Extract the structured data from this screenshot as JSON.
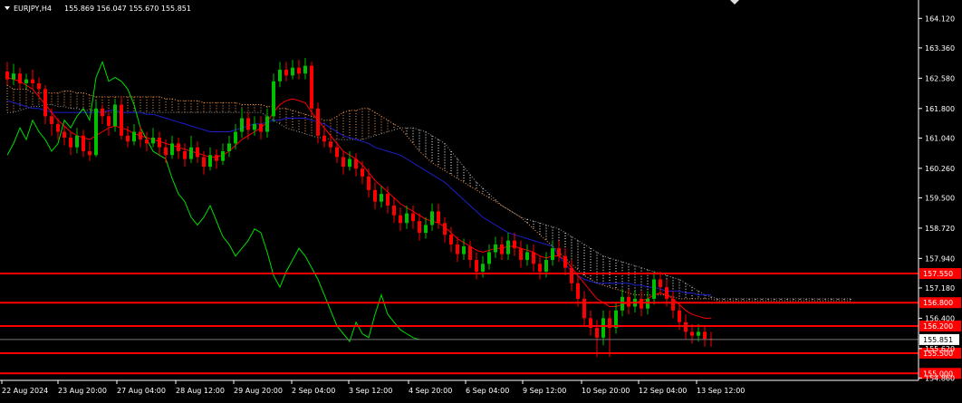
{
  "header": {
    "symbol_label": "EURJPY,H4",
    "ohlc": "155.869 156.047 155.670 155.851"
  },
  "colors": {
    "background": "#000000",
    "axis": "#ffffff",
    "bull": "#00c000",
    "bear": "#ff0000",
    "tenkan": "#ff0000",
    "kijun": "#1e1ecc",
    "chikou": "#00dd00",
    "cloud_a": "#ff9a4a",
    "cloud_b": "#ffffff",
    "level": "#ff0000",
    "current_price_box": "#ffffff"
  },
  "chart_data": {
    "type": "candlestick",
    "ylim": [
      154.8,
      164.5
    ],
    "y_ticks": [
      "164.120",
      "163.360",
      "162.580",
      "161.800",
      "161.040",
      "160.260",
      "159.500",
      "158.720",
      "157.940",
      "157.180",
      "156.400",
      "155.620",
      "154.860"
    ],
    "x_ticks": [
      "22 Aug 2024",
      "23 Aug 20:00",
      "27 Aug 04:00",
      "28 Aug 12:00",
      "29 Aug 20:00",
      "2 Sep 04:00",
      "3 Sep 12:00",
      "4 Sep 20:00",
      "6 Sep 04:00",
      "9 Sep 12:00",
      "10 Sep 20:00",
      "12 Sep 04:00",
      "13 Sep 12:00"
    ],
    "levels": [
      {
        "label": "157.550",
        "value": 157.55
      },
      {
        "label": "156.800",
        "value": 156.8
      },
      {
        "label": "156.200",
        "value": 156.2
      },
      {
        "label": "155.500",
        "value": 155.5
      },
      {
        "label": "155.000",
        "value": 154.98
      }
    ],
    "current_price": {
      "label": "155.851",
      "value": 155.851
    },
    "candles": [
      [
        162.75,
        162.55,
        163.0,
        162.4
      ],
      [
        162.55,
        162.7,
        162.95,
        162.4
      ],
      [
        162.7,
        162.45,
        162.85,
        162.3
      ],
      [
        162.45,
        162.55,
        162.7,
        162.3
      ],
      [
        162.55,
        162.45,
        162.8,
        162.3
      ],
      [
        162.45,
        162.3,
        162.6,
        162.1
      ],
      [
        162.3,
        161.6,
        162.4,
        161.4
      ],
      [
        161.6,
        161.4,
        161.8,
        161.1
      ],
      [
        161.4,
        161.2,
        161.55,
        161.0
      ],
      [
        161.2,
        161.05,
        161.35,
        160.85
      ],
      [
        161.05,
        160.8,
        161.2,
        160.6
      ],
      [
        160.8,
        161.1,
        161.3,
        160.65
      ],
      [
        161.1,
        160.7,
        161.25,
        160.55
      ],
      [
        160.7,
        160.6,
        160.95,
        160.45
      ],
      [
        160.6,
        161.8,
        162.0,
        160.55
      ],
      [
        161.8,
        161.6,
        161.9,
        161.4
      ],
      [
        161.6,
        161.35,
        161.75,
        161.1
      ],
      [
        161.35,
        161.9,
        162.05,
        161.2
      ],
      [
        161.9,
        161.1,
        162.1,
        161.0
      ],
      [
        161.1,
        160.95,
        161.35,
        160.8
      ],
      [
        160.95,
        161.2,
        161.4,
        160.85
      ],
      [
        161.2,
        161.0,
        161.35,
        160.8
      ],
      [
        161.0,
        160.9,
        161.2,
        160.7
      ],
      [
        160.9,
        161.05,
        161.3,
        160.8
      ],
      [
        161.05,
        160.8,
        161.2,
        160.6
      ],
      [
        160.8,
        160.6,
        161.0,
        160.4
      ],
      [
        160.6,
        160.9,
        161.1,
        160.5
      ],
      [
        160.9,
        160.7,
        161.05,
        160.5
      ],
      [
        160.7,
        160.5,
        160.9,
        160.3
      ],
      [
        160.5,
        160.8,
        161.1,
        160.4
      ],
      [
        160.8,
        160.55,
        160.95,
        160.4
      ],
      [
        160.55,
        160.3,
        160.7,
        160.1
      ],
      [
        160.3,
        160.6,
        160.8,
        160.2
      ],
      [
        160.6,
        160.45,
        160.75,
        160.25
      ],
      [
        160.45,
        160.7,
        160.9,
        160.35
      ],
      [
        160.7,
        160.9,
        161.1,
        160.55
      ],
      [
        160.9,
        161.2,
        161.4,
        160.75
      ],
      [
        161.2,
        161.55,
        161.8,
        161.05
      ],
      [
        161.55,
        161.25,
        161.7,
        161.0
      ],
      [
        161.25,
        161.4,
        161.6,
        161.1
      ],
      [
        161.4,
        161.2,
        161.6,
        161.0
      ],
      [
        161.2,
        161.6,
        161.8,
        161.05
      ],
      [
        161.6,
        162.5,
        162.7,
        161.45
      ],
      [
        162.5,
        162.8,
        163.0,
        162.35
      ],
      [
        162.8,
        162.65,
        163.0,
        162.5
      ],
      [
        162.65,
        162.85,
        163.05,
        162.55
      ],
      [
        162.85,
        162.7,
        163.05,
        162.55
      ],
      [
        162.7,
        162.9,
        163.1,
        162.55
      ],
      [
        162.9,
        161.8,
        163.0,
        161.6
      ],
      [
        161.8,
        161.1,
        161.95,
        160.9
      ],
      [
        161.1,
        160.95,
        161.35,
        160.8
      ],
      [
        160.95,
        160.8,
        161.1,
        160.65
      ],
      [
        160.8,
        160.55,
        160.95,
        160.4
      ],
      [
        160.55,
        160.3,
        160.7,
        160.1
      ],
      [
        160.3,
        160.5,
        160.7,
        160.2
      ],
      [
        160.5,
        160.25,
        160.65,
        160.05
      ],
      [
        160.25,
        160.05,
        160.45,
        159.85
      ],
      [
        160.05,
        159.7,
        160.25,
        159.5
      ],
      [
        159.7,
        159.4,
        159.9,
        159.2
      ],
      [
        159.4,
        159.6,
        159.8,
        159.25
      ],
      [
        159.6,
        159.3,
        159.8,
        159.1
      ],
      [
        159.3,
        159.05,
        159.5,
        158.85
      ],
      [
        159.05,
        158.85,
        159.25,
        158.65
      ],
      [
        158.85,
        159.1,
        159.3,
        158.7
      ],
      [
        159.1,
        158.9,
        159.3,
        158.7
      ],
      [
        158.9,
        158.6,
        159.1,
        158.4
      ],
      [
        158.6,
        158.8,
        159.0,
        158.45
      ],
      [
        158.8,
        159.15,
        159.35,
        158.65
      ],
      [
        159.15,
        158.85,
        159.35,
        158.7
      ],
      [
        158.85,
        158.55,
        159.0,
        158.35
      ],
      [
        158.55,
        158.3,
        158.75,
        158.1
      ],
      [
        158.3,
        158.05,
        158.5,
        157.85
      ],
      [
        158.05,
        158.25,
        158.45,
        157.9
      ],
      [
        158.25,
        157.9,
        158.4,
        157.7
      ],
      [
        157.9,
        157.6,
        158.1,
        157.4
      ],
      [
        157.6,
        157.8,
        158.0,
        157.45
      ],
      [
        157.8,
        158.1,
        158.3,
        157.65
      ],
      [
        158.1,
        158.3,
        158.5,
        157.95
      ],
      [
        158.3,
        158.05,
        158.5,
        157.9
      ],
      [
        158.05,
        158.4,
        158.6,
        157.9
      ],
      [
        158.4,
        158.2,
        158.6,
        158.0
      ],
      [
        158.2,
        157.9,
        158.4,
        157.7
      ],
      [
        157.9,
        158.1,
        158.3,
        157.75
      ],
      [
        158.1,
        157.8,
        158.3,
        157.6
      ],
      [
        157.8,
        157.6,
        158.0,
        157.4
      ],
      [
        157.6,
        157.9,
        158.1,
        157.45
      ],
      [
        157.9,
        158.2,
        158.4,
        157.75
      ],
      [
        158.2,
        158.0,
        158.4,
        157.85
      ],
      [
        158.0,
        157.7,
        158.2,
        157.5
      ],
      [
        157.7,
        157.3,
        157.9,
        157.1
      ],
      [
        157.3,
        156.9,
        157.5,
        156.7
      ],
      [
        156.9,
        156.4,
        157.1,
        156.2
      ],
      [
        156.4,
        156.15,
        156.6,
        155.95
      ],
      [
        156.15,
        155.9,
        156.35,
        155.4
      ],
      [
        155.9,
        156.4,
        156.6,
        155.7
      ],
      [
        156.4,
        156.15,
        156.6,
        155.4
      ],
      [
        156.15,
        156.6,
        156.8,
        156.0
      ],
      [
        156.6,
        156.95,
        157.15,
        156.45
      ],
      [
        156.95,
        156.7,
        157.15,
        156.5
      ],
      [
        156.7,
        156.9,
        157.1,
        156.55
      ],
      [
        156.9,
        156.65,
        157.1,
        156.45
      ],
      [
        156.65,
        156.9,
        157.1,
        156.5
      ],
      [
        156.9,
        157.4,
        157.6,
        156.75
      ],
      [
        157.4,
        157.2,
        157.6,
        157.0
      ],
      [
        157.2,
        156.9,
        157.4,
        156.7
      ],
      [
        156.9,
        156.6,
        157.1,
        156.4
      ],
      [
        156.6,
        156.3,
        156.8,
        156.1
      ],
      [
        156.3,
        156.05,
        156.5,
        155.85
      ],
      [
        156.05,
        155.95,
        156.25,
        155.75
      ],
      [
        155.95,
        156.05,
        156.25,
        155.8
      ],
      [
        156.05,
        155.87,
        156.2,
        155.67
      ],
      [
        155.87,
        155.85,
        156.05,
        155.67
      ]
    ],
    "tenkan": [
      162.6,
      162.55,
      162.5,
      162.4,
      162.3,
      162.1,
      161.9,
      161.7,
      161.5,
      161.35,
      161.2,
      161.1,
      161.05,
      161.0,
      161.1,
      161.2,
      161.3,
      161.35,
      161.3,
      161.25,
      161.15,
      161.1,
      161.05,
      161.0,
      160.95,
      160.9,
      160.85,
      160.8,
      160.75,
      160.7,
      160.65,
      160.6,
      160.55,
      160.55,
      160.6,
      160.7,
      160.85,
      161.0,
      161.1,
      161.2,
      161.3,
      161.45,
      161.7,
      161.9,
      162.0,
      162.05,
      162.0,
      161.95,
      161.7,
      161.5,
      161.3,
      161.1,
      160.9,
      160.7,
      160.6,
      160.5,
      160.35,
      160.15,
      159.95,
      159.8,
      159.65,
      159.5,
      159.35,
      159.25,
      159.15,
      159.05,
      158.95,
      158.9,
      158.85,
      158.75,
      158.6,
      158.45,
      158.35,
      158.25,
      158.15,
      158.1,
      158.15,
      158.2,
      158.2,
      158.25,
      158.25,
      158.2,
      158.15,
      158.1,
      158.0,
      157.95,
      158.0,
      158.0,
      157.9,
      157.7,
      157.5,
      157.3,
      157.1,
      156.9,
      156.8,
      156.7,
      156.7,
      156.75,
      156.8,
      156.8,
      156.85,
      156.9,
      157.0,
      157.05,
      157.0,
      156.9,
      156.75,
      156.6,
      156.5,
      156.45,
      156.4,
      156.4
    ],
    "kijun": [
      162.0,
      161.95,
      161.9,
      161.85,
      161.8,
      161.8,
      161.75,
      161.7,
      161.7,
      161.7,
      161.7,
      161.7,
      161.7,
      161.7,
      161.7,
      161.7,
      161.75,
      161.75,
      161.7,
      161.7,
      161.7,
      161.7,
      161.65,
      161.65,
      161.6,
      161.55,
      161.5,
      161.45,
      161.4,
      161.35,
      161.3,
      161.25,
      161.2,
      161.2,
      161.2,
      161.2,
      161.25,
      161.3,
      161.35,
      161.4,
      161.4,
      161.45,
      161.5,
      161.5,
      161.55,
      161.55,
      161.55,
      161.55,
      161.5,
      161.45,
      161.4,
      161.3,
      161.2,
      161.1,
      161.05,
      161.0,
      160.95,
      160.9,
      160.8,
      160.75,
      160.7,
      160.65,
      160.6,
      160.5,
      160.4,
      160.3,
      160.2,
      160.1,
      160.0,
      159.9,
      159.75,
      159.6,
      159.45,
      159.3,
      159.15,
      159.0,
      158.9,
      158.8,
      158.7,
      158.6,
      158.55,
      158.5,
      158.45,
      158.4,
      158.35,
      158.3,
      158.25,
      158.0,
      157.8,
      157.6,
      157.5,
      157.4,
      157.35,
      157.3,
      157.3,
      157.3,
      157.3,
      157.3,
      157.3,
      157.25,
      157.25,
      157.2,
      157.2,
      157.15,
      157.1,
      157.1,
      157.1,
      157.05,
      157.05,
      157.0,
      157.0,
      157.0
    ],
    "chikou": [
      160.6,
      160.9,
      161.3,
      161.0,
      161.5,
      161.2,
      161.0,
      160.7,
      160.9,
      161.5,
      161.3,
      161.6,
      161.8,
      161.5,
      162.6,
      163.0,
      162.5,
      162.6,
      162.5,
      162.3,
      161.9,
      161.3,
      161.0,
      160.7,
      160.6,
      160.5,
      160.0,
      159.6,
      159.4,
      159.0,
      158.8,
      159.0,
      159.3,
      158.9,
      158.5,
      158.3,
      158.0,
      158.2,
      158.4,
      158.7,
      158.6,
      158.1,
      157.5,
      157.2,
      157.6,
      157.9,
      158.2,
      158.0,
      157.7,
      157.4,
      157.0,
      156.6,
      156.2,
      156.0,
      155.8,
      156.3,
      156.0,
      155.9,
      156.5,
      157.0,
      156.5,
      156.3,
      156.1,
      156.0,
      155.9,
      155.85
    ],
    "span_a": [
      162.4,
      162.3,
      162.3,
      162.3,
      162.2,
      162.2,
      162.2,
      162.2,
      162.2,
      162.25,
      162.25,
      162.2,
      162.2,
      162.15,
      162.1,
      162.1,
      162.1,
      162.1,
      162.1,
      162.1,
      162.1,
      162.1,
      162.1,
      162.1,
      162.1,
      162.05,
      162.05,
      162.0,
      162.0,
      162.0,
      162.0,
      161.95,
      161.95,
      161.95,
      161.95,
      161.95,
      161.95,
      161.9,
      161.9,
      161.9,
      161.9,
      161.85,
      161.85,
      161.8,
      161.8,
      161.75,
      161.7,
      161.65,
      161.6,
      161.55,
      161.5,
      161.5,
      161.6,
      161.7,
      161.75,
      161.75,
      161.8,
      161.8,
      161.7,
      161.6,
      161.5,
      161.4,
      161.3,
      161.1,
      160.9,
      160.7,
      160.55,
      160.4,
      160.3,
      160.2,
      160.1,
      160.0,
      159.9,
      159.8,
      159.7,
      159.6,
      159.5,
      159.4,
      159.3,
      159.2,
      159.1,
      159.0,
      158.85,
      158.7,
      158.55,
      158.4,
      158.25,
      158.1,
      157.95,
      157.8,
      157.65,
      157.5,
      157.4,
      157.3,
      157.25,
      157.2,
      157.15,
      157.1,
      157.05,
      157.0,
      157.0,
      157.0,
      157.0,
      157.0,
      157.0,
      156.95,
      156.9,
      156.9,
      156.9,
      156.9,
      156.9,
      156.9,
      156.85,
      156.85,
      156.85,
      156.85,
      156.85,
      156.85,
      156.85,
      156.85,
      156.85,
      156.85,
      156.85,
      156.85,
      156.85,
      156.85,
      156.85,
      156.85,
      156.85,
      156.85,
      156.85,
      156.85,
      156.85,
      156.85
    ],
    "span_b": [
      161.7,
      161.7,
      161.75,
      161.8,
      161.85,
      161.85,
      161.9,
      161.9,
      161.85,
      161.85,
      161.8,
      161.8,
      161.75,
      161.75,
      161.75,
      161.7,
      161.7,
      161.7,
      161.7,
      161.7,
      161.7,
      161.7,
      161.7,
      161.7,
      161.7,
      161.7,
      161.7,
      161.7,
      161.7,
      161.7,
      161.7,
      161.7,
      161.7,
      161.7,
      161.7,
      161.7,
      161.7,
      161.7,
      161.7,
      161.7,
      161.7,
      161.6,
      161.5,
      161.4,
      161.3,
      161.25,
      161.2,
      161.15,
      161.1,
      161.05,
      161.05,
      161.0,
      161.0,
      161.0,
      161.0,
      161.0,
      161.0,
      161.05,
      161.1,
      161.15,
      161.2,
      161.25,
      161.3,
      161.3,
      161.3,
      161.25,
      161.2,
      161.1,
      161.0,
      160.9,
      160.7,
      160.5,
      160.3,
      160.1,
      159.9,
      159.75,
      159.6,
      159.45,
      159.3,
      159.2,
      159.1,
      159.0,
      158.95,
      158.9,
      158.85,
      158.8,
      158.75,
      158.7,
      158.6,
      158.5,
      158.4,
      158.3,
      158.2,
      158.1,
      158.0,
      157.95,
      157.9,
      157.85,
      157.8,
      157.75,
      157.7,
      157.65,
      157.6,
      157.55,
      157.5,
      157.45,
      157.4,
      157.3,
      157.2,
      157.1,
      157.0,
      156.95,
      156.9,
      156.9,
      156.9,
      156.9,
      156.9,
      156.9,
      156.9,
      156.9,
      156.9,
      156.9,
      156.9,
      156.9,
      156.9,
      156.9,
      156.9,
      156.9,
      156.9,
      156.9,
      156.9,
      156.9,
      156.9,
      156.9
    ]
  }
}
